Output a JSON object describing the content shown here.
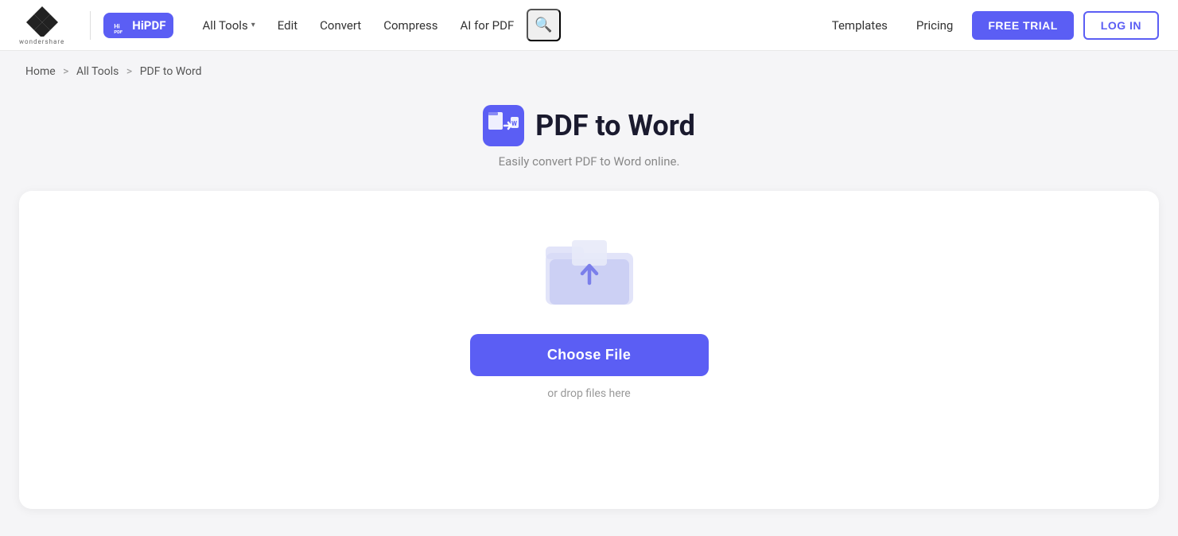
{
  "brand": {
    "wondershare_text": "wondershare",
    "hipdf_label": "HiPDF"
  },
  "navbar": {
    "all_tools_label": "All Tools",
    "edit_label": "Edit",
    "convert_label": "Convert",
    "compress_label": "Compress",
    "ai_for_pdf_label": "AI for PDF",
    "templates_label": "Templates",
    "pricing_label": "Pricing",
    "free_trial_label": "FREE TRIAL",
    "login_label": "LOG IN"
  },
  "breadcrumb": {
    "home": "Home",
    "all_tools": "All Tools",
    "current": "PDF to Word"
  },
  "page": {
    "title": "PDF to Word",
    "subtitle": "Easily convert PDF to Word online."
  },
  "upload": {
    "choose_file_label": "Choose File",
    "drop_hint": "or drop files here"
  }
}
